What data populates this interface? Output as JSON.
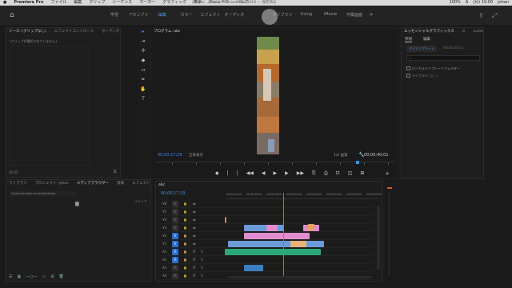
{
  "menubar": {
    "app": "Premiere Pro",
    "items": [
      "ファイル",
      "編集",
      "クリップ",
      "シーケンス",
      "マーカー",
      "グラフィック",
      "表示",
      "ウィンドウ",
      "ヘルプ"
    ],
    "title_text": "/Users/.../Adobe Premiere Pro/ 2019 — 保存済み",
    "right_items": [
      "100%",
      "A",
      "(月) 10:00",
      "johan"
    ]
  },
  "workspaces": {
    "tabs": [
      "学習",
      "アセンブリ",
      "編集",
      "カラー",
      "エフェクト",
      "オーディオ",
      "",
      "ライブラリ",
      "Irving",
      "iMovie",
      "作業画面"
    ],
    "active_index": 2
  },
  "source_panel": {
    "tabs": [
      "ソース: (クリップなし)",
      "エフェクトコントロール",
      "オーディオクリップミキサー: johan"
    ],
    "active_tab": 0,
    "message": "(クリップが選択されていません)",
    "footer": "00:00"
  },
  "tools": [
    "select-tool",
    "track-select-tool",
    "ripple-edit-tool",
    "razor-tool",
    "slip-tool",
    "pen-tool",
    "hand-tool",
    "type-tool"
  ],
  "program": {
    "tab": "プログラム: abc",
    "timecode_left": "00;00;17;29",
    "fit": "全体表示",
    "quality": "1/2 画質",
    "timecode_right": "00;00;40;01",
    "transport": [
      "◆",
      "|",
      "|",
      "◀◀",
      "◀",
      "▶",
      "▶",
      "▶▶",
      "⎘",
      "⎙",
      "⊡",
      "◫",
      "⊞"
    ]
  },
  "essential": {
    "tabs": [
      "エッセンシャルグラフィックス",
      "≡",
      "Lumetri カラー"
    ],
    "sub_tabs": [
      "参照",
      "編集"
    ],
    "my_templates": "マイテンプレート",
    "adobe_stock": "Adobe Stock",
    "search_placeholder": "",
    "row1": "ローカルテンプレートフォルダー",
    "row2": "ライブラリ",
    "row2_value": "(なし)"
  },
  "project": {
    "tabs": [
      "ライブラリ",
      "プロジェクト: johan",
      "メディアブラウザー",
      "情報",
      "エフェクト"
    ],
    "path": "/Users/shutterstock/Desktop/",
    "right_label": "メディア",
    "footer_icons": [
      "list-view",
      "icon-view",
      "zoom-slider",
      "new-bin",
      "new-item",
      "clear"
    ]
  },
  "timeline": {
    "tab": "abc",
    "timecode": "00;00;17;29",
    "ruler": [
      "00;00;14;00",
      "00;00;16;00",
      "00;00;18;00",
      "00;00;20;00",
      "00;00;22;00",
      "00;00;24;00",
      "00;00;26;00",
      "00;00;28;00"
    ],
    "tracks": [
      {
        "name": "V6"
      },
      {
        "name": "V5"
      },
      {
        "name": "V4"
      },
      {
        "name": "V3"
      },
      {
        "name": "V2"
      },
      {
        "name": "V1"
      },
      {
        "name": "A1"
      },
      {
        "name": "A2"
      },
      {
        "name": "A3"
      },
      {
        "name": "A4"
      }
    ],
    "clips": [
      {
        "track": 3,
        "label": "",
        "color": "#6b9bd8"
      },
      {
        "track": 3,
        "label": "",
        "color": "#e08cd0"
      },
      {
        "track": 4,
        "label": "",
        "color": "#e08cd0"
      },
      {
        "track": 5,
        "label": "",
        "color": "#6b9bd8"
      },
      {
        "track": 5,
        "label": "",
        "color": "#e7b07b"
      },
      {
        "track": 6,
        "label": "",
        "color": "#2aa879"
      },
      {
        "track": 8,
        "label": "",
        "color": "#3b7fc0"
      }
    ]
  }
}
